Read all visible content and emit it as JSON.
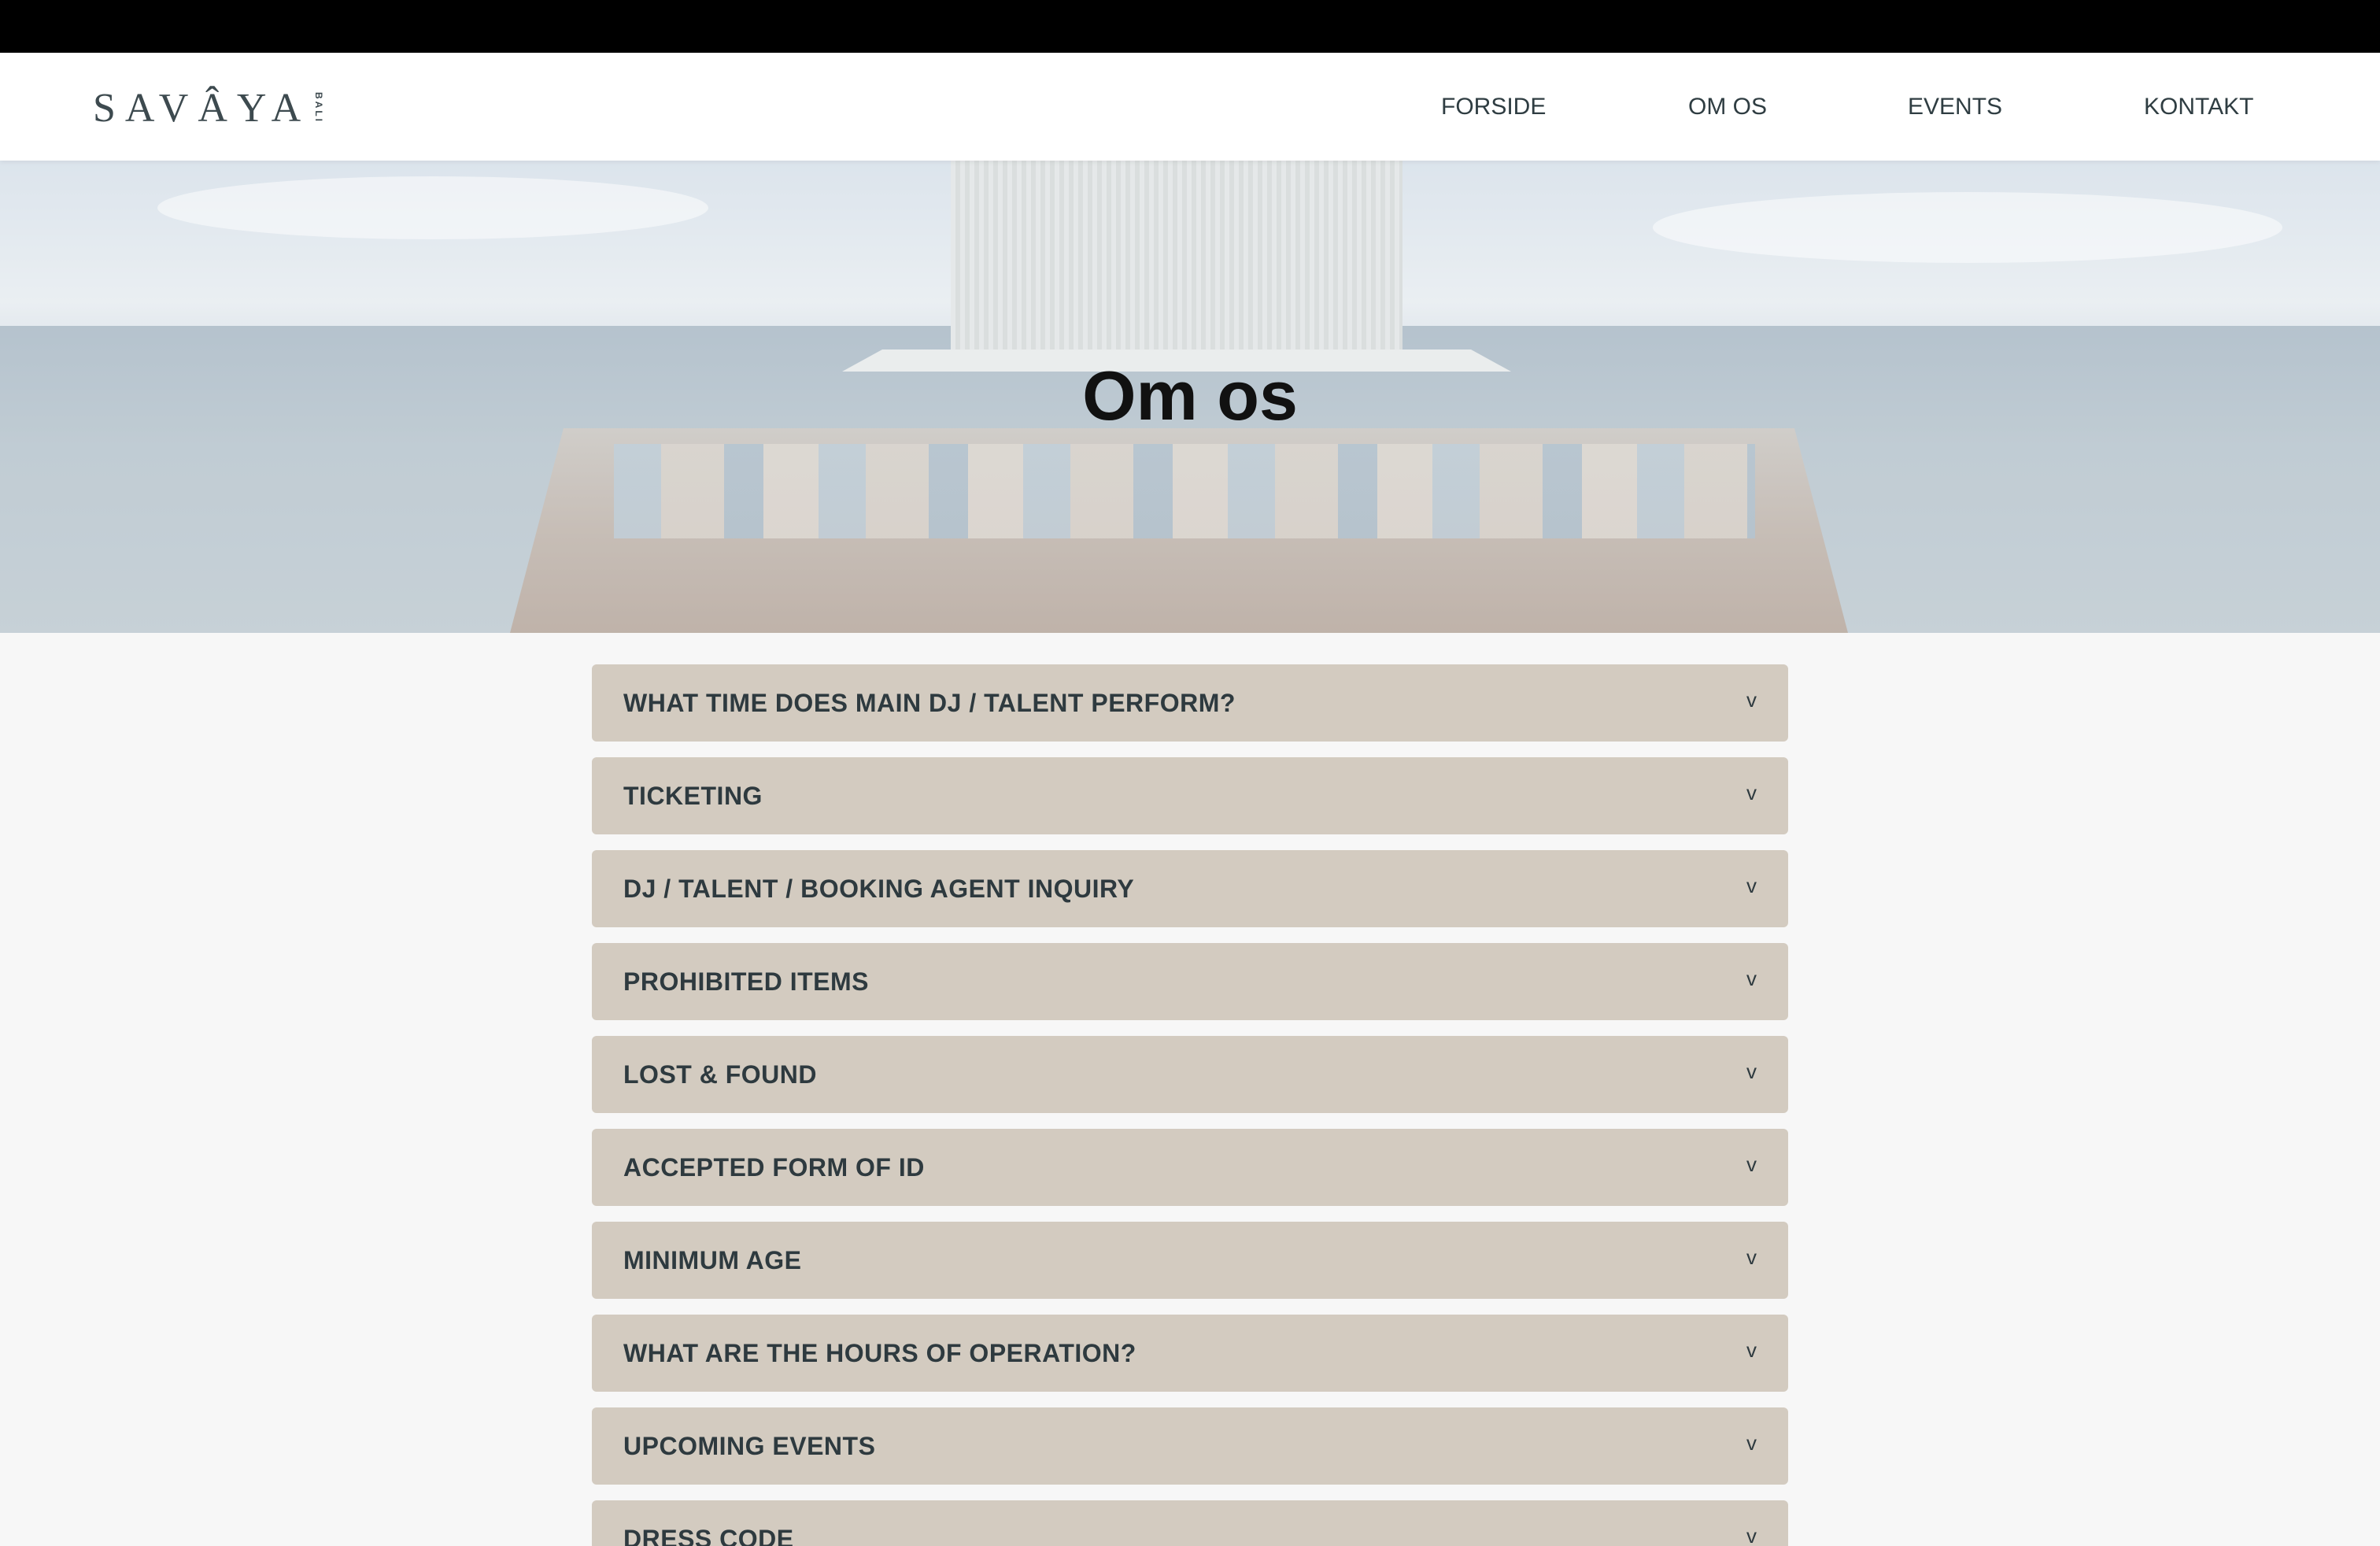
{
  "header": {
    "logo_text": "SAVÂYA",
    "logo_sub": "BALI",
    "nav": [
      {
        "label": "FORSIDE"
      },
      {
        "label": "OM OS"
      },
      {
        "label": "EVENTS"
      },
      {
        "label": "KONTAKT"
      }
    ]
  },
  "hero": {
    "title": "Om os"
  },
  "faq": {
    "chevron": "v",
    "items": [
      {
        "question": "WHAT TIME DOES MAIN DJ / TALENT PERFORM?"
      },
      {
        "question": "TICKETING"
      },
      {
        "question": "DJ / TALENT / BOOKING AGENT INQUIRY"
      },
      {
        "question": "PROHIBITED ITEMS"
      },
      {
        "question": "LOST & FOUND"
      },
      {
        "question": "ACCEPTED FORM OF ID"
      },
      {
        "question": "MINIMUM AGE"
      },
      {
        "question": "WHAT ARE THE HOURS OF OPERATION?"
      },
      {
        "question": "UPCOMING EVENTS"
      },
      {
        "question": "DRESS CODE"
      }
    ]
  },
  "colors": {
    "accordion_bg": "#d3cbc0",
    "text_dark": "#2e3a3f",
    "top_bar": "#000000",
    "page_bg": "#f7f7f7"
  }
}
